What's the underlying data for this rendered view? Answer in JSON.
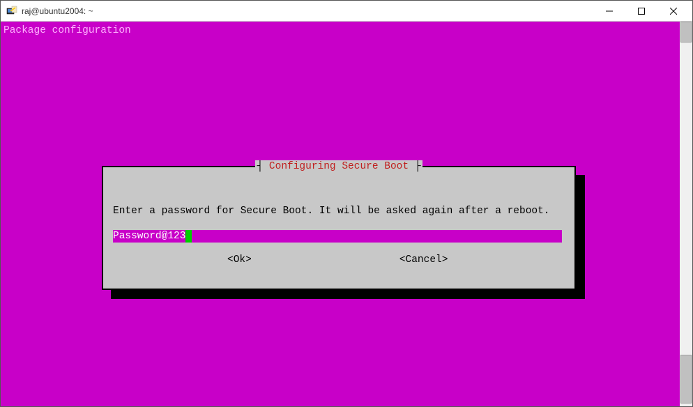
{
  "window": {
    "title": "raj@ubuntu2004: ~"
  },
  "terminal": {
    "header": "Package configuration"
  },
  "dialog": {
    "title": "Configuring Secure Boot",
    "prompt": "Enter a password for Secure Boot. It will be asked again after a reboot.",
    "password_value": "Password@123",
    "ok_label": "<Ok>",
    "cancel_label": "<Cancel>"
  }
}
